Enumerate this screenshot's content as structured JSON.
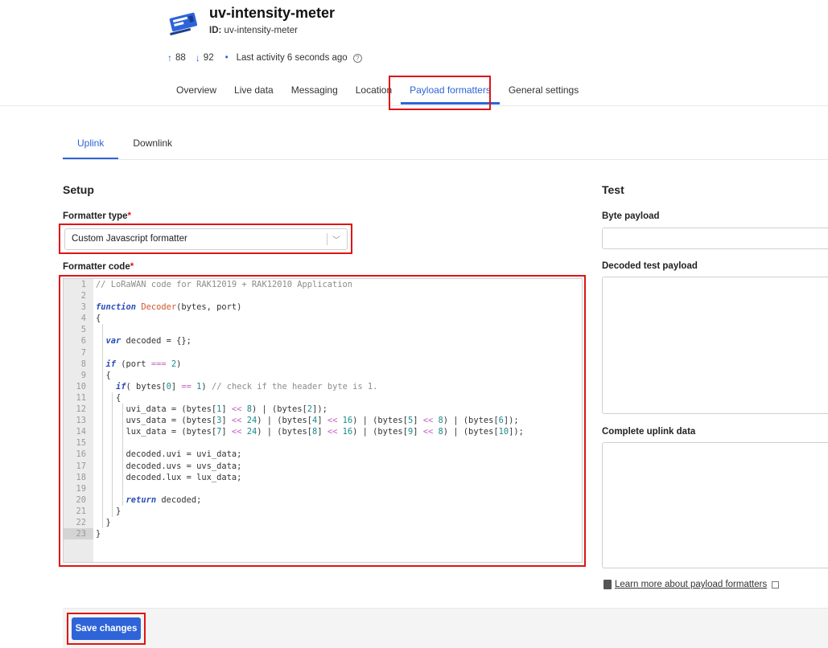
{
  "device": {
    "name": "uv-intensity-meter",
    "id_label": "ID:",
    "id_value": "uv-intensity-meter",
    "uplink_count": "88",
    "downlink_count": "92",
    "last_activity": "Last activity 6 seconds ago"
  },
  "topnav": {
    "tabs": [
      {
        "label": "Overview"
      },
      {
        "label": "Live data"
      },
      {
        "label": "Messaging"
      },
      {
        "label": "Location"
      },
      {
        "label": "Payload formatters"
      },
      {
        "label": "General settings"
      }
    ],
    "active": "Payload formatters"
  },
  "subnav": {
    "tabs": [
      {
        "label": "Uplink"
      },
      {
        "label": "Downlink"
      }
    ],
    "active": "Uplink"
  },
  "setup": {
    "title": "Setup",
    "formatter_type_label": "Formatter type",
    "formatter_type_value": "Custom Javascript formatter",
    "formatter_code_label": "Formatter code",
    "required_mark": "*"
  },
  "code_lines": [
    "// LoRaWAN code for RAK12019 + RAK12010 Application",
    "",
    "function Decoder(bytes, port)",
    "{",
    "",
    "  var decoded = {};",
    "",
    "  if (port === 2)",
    "  {",
    "    if( bytes[0] == 1) // check if the header byte is 1.",
    "    {",
    "      uvi_data = (bytes[1] << 8) | (bytes[2]);",
    "      uvs_data = (bytes[3] << 24) | (bytes[4] << 16) | (bytes[5] << 8) | (bytes[6]);",
    "      lux_data = (bytes[7] << 24) | (bytes[8] << 16) | (bytes[9] << 8) | (bytes[10]);",
    "",
    "      decoded.uvi = uvi_data;",
    "      decoded.uvs = uvs_data;",
    "      decoded.lux = lux_data;",
    "",
    "      return decoded;",
    "    }",
    "  }",
    "}"
  ],
  "test": {
    "title": "Test",
    "byte_payload_label": "Byte payload",
    "byte_payload_value": "",
    "decoded_label": "Decoded test payload",
    "complete_label": "Complete uplink data",
    "learn_more": "Learn more about payload formatters"
  },
  "footer": {
    "save_label": "Save changes"
  },
  "colors": {
    "accent": "#2e64d8",
    "highlight": "#e01414",
    "required": "#d61c1c"
  },
  "icons": {
    "device": "device-board-icon",
    "uplink": "arrow-up-icon",
    "downlink": "arrow-down-icon",
    "help": "help-circle-icon",
    "chevron": "chevron-down-icon",
    "book": "book-icon",
    "external": "external-link-icon"
  }
}
